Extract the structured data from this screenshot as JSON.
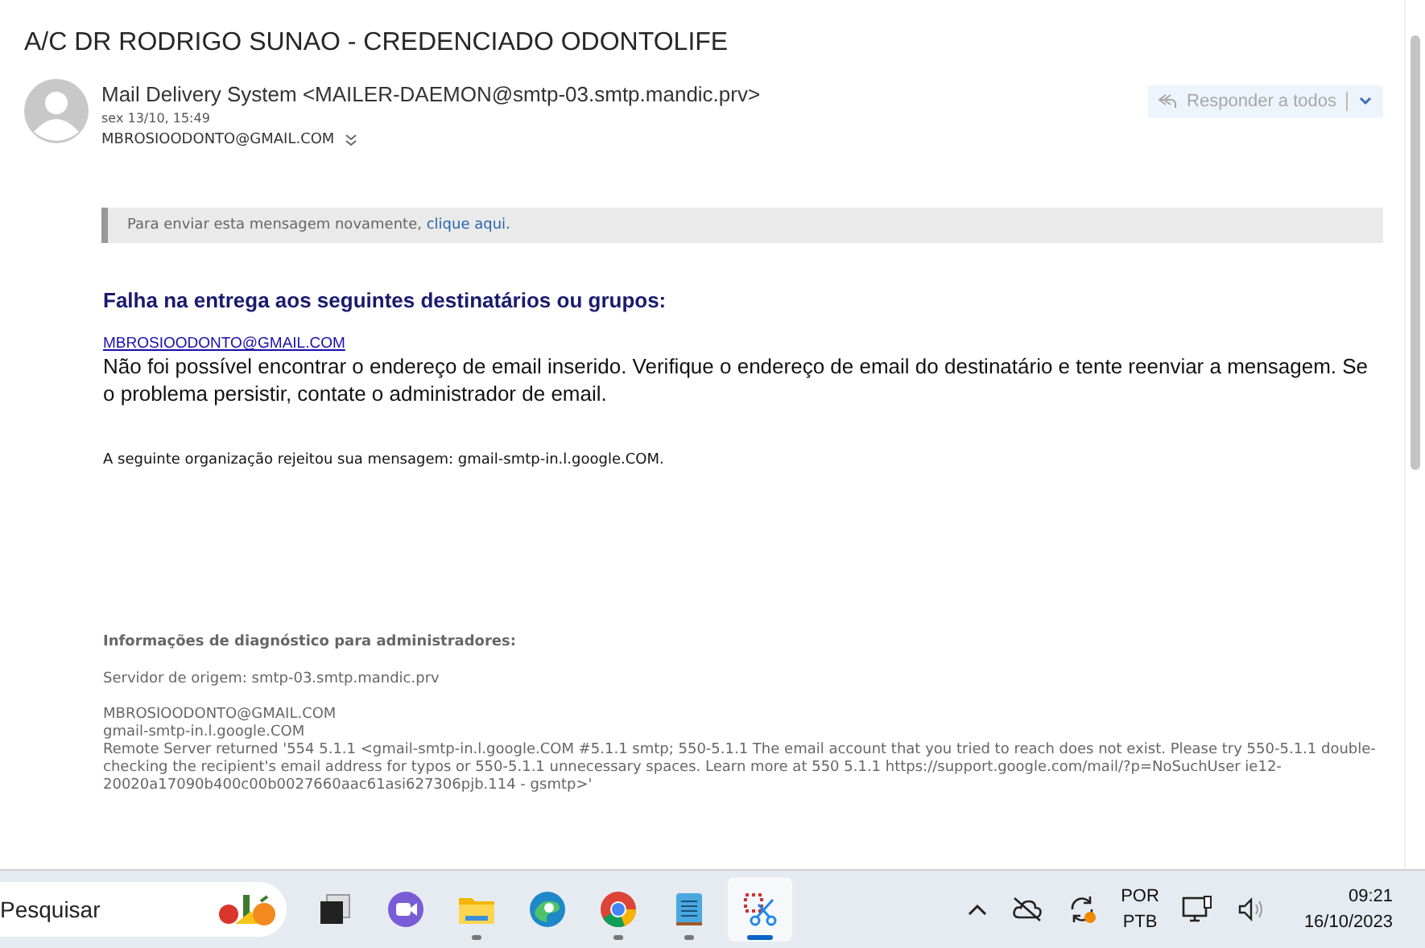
{
  "subject": "A/C DR RODRIGO SUNAO - CREDENCIADO ODONTOLIFE",
  "message": {
    "sender": "Mail Delivery System <MAILER-DAEMON@smtp-03.smtp.mandic.prv>",
    "date": "sex 13/10, 15:49",
    "to": "MBROSIOODONTO@GMAIL.COM",
    "reply_button": {
      "label": "Responder a todos",
      "disabled": true
    }
  },
  "resend_notice": {
    "text": "Para enviar esta mensagem novamente,",
    "link": "clique aqui."
  },
  "body": {
    "heading": "Falha na entrega aos seguintes destinatários ou grupos:",
    "recipient_link": "MBROSIOODONTO@GMAIL.COM",
    "explanation": "Não foi possível encontrar o endereço de email inserido. Verifique o endereço de email do destinatário e tente reenviar a mensagem. Se o problema persistir, contate o administrador de email.",
    "rejection": "A seguinte organização rejeitou sua mensagem: gmail-smtp-in.l.google.COM."
  },
  "diagnostics": {
    "heading": "Informações de diagnóstico para administradores:",
    "origin": "Servidor de origem: smtp-03.smtp.mandic.prv",
    "lines": [
      "MBROSIOODONTO@GMAIL.COM",
      "gmail-smtp-in.l.google.COM",
      "Remote Server returned '554 5.1.1 <gmail-smtp-in.l.google.COM #5.1.1 smtp; 550-5.1.1 The email account that you tried to reach does not exist. Please try 550-5.1.1 double-checking the recipient's email address for typos or 550-5.1.1 unnecessary spaces. Learn more at 550 5.1.1 https://support.google.com/mail/?p=NoSuchUser ie12-20020a17090b400c00b0027660aac61asi627306pjb.114 - gsmtp>'"
    ]
  },
  "taskbar": {
    "search_placeholder": "Pesquisar",
    "apps": [
      {
        "kind": "taskview",
        "running": false,
        "selected": false
      },
      {
        "kind": "chat",
        "running": false,
        "selected": false
      },
      {
        "kind": "folder",
        "running": true,
        "selected": false
      },
      {
        "kind": "edge",
        "running": false,
        "selected": false
      },
      {
        "kind": "chrome",
        "running": true,
        "selected": false
      },
      {
        "kind": "notepad",
        "running": true,
        "selected": false
      },
      {
        "kind": "snip",
        "running": true,
        "selected": true
      }
    ],
    "language": [
      "POR",
      "PTB"
    ],
    "time": "09:21",
    "date": "16/10/2023"
  }
}
